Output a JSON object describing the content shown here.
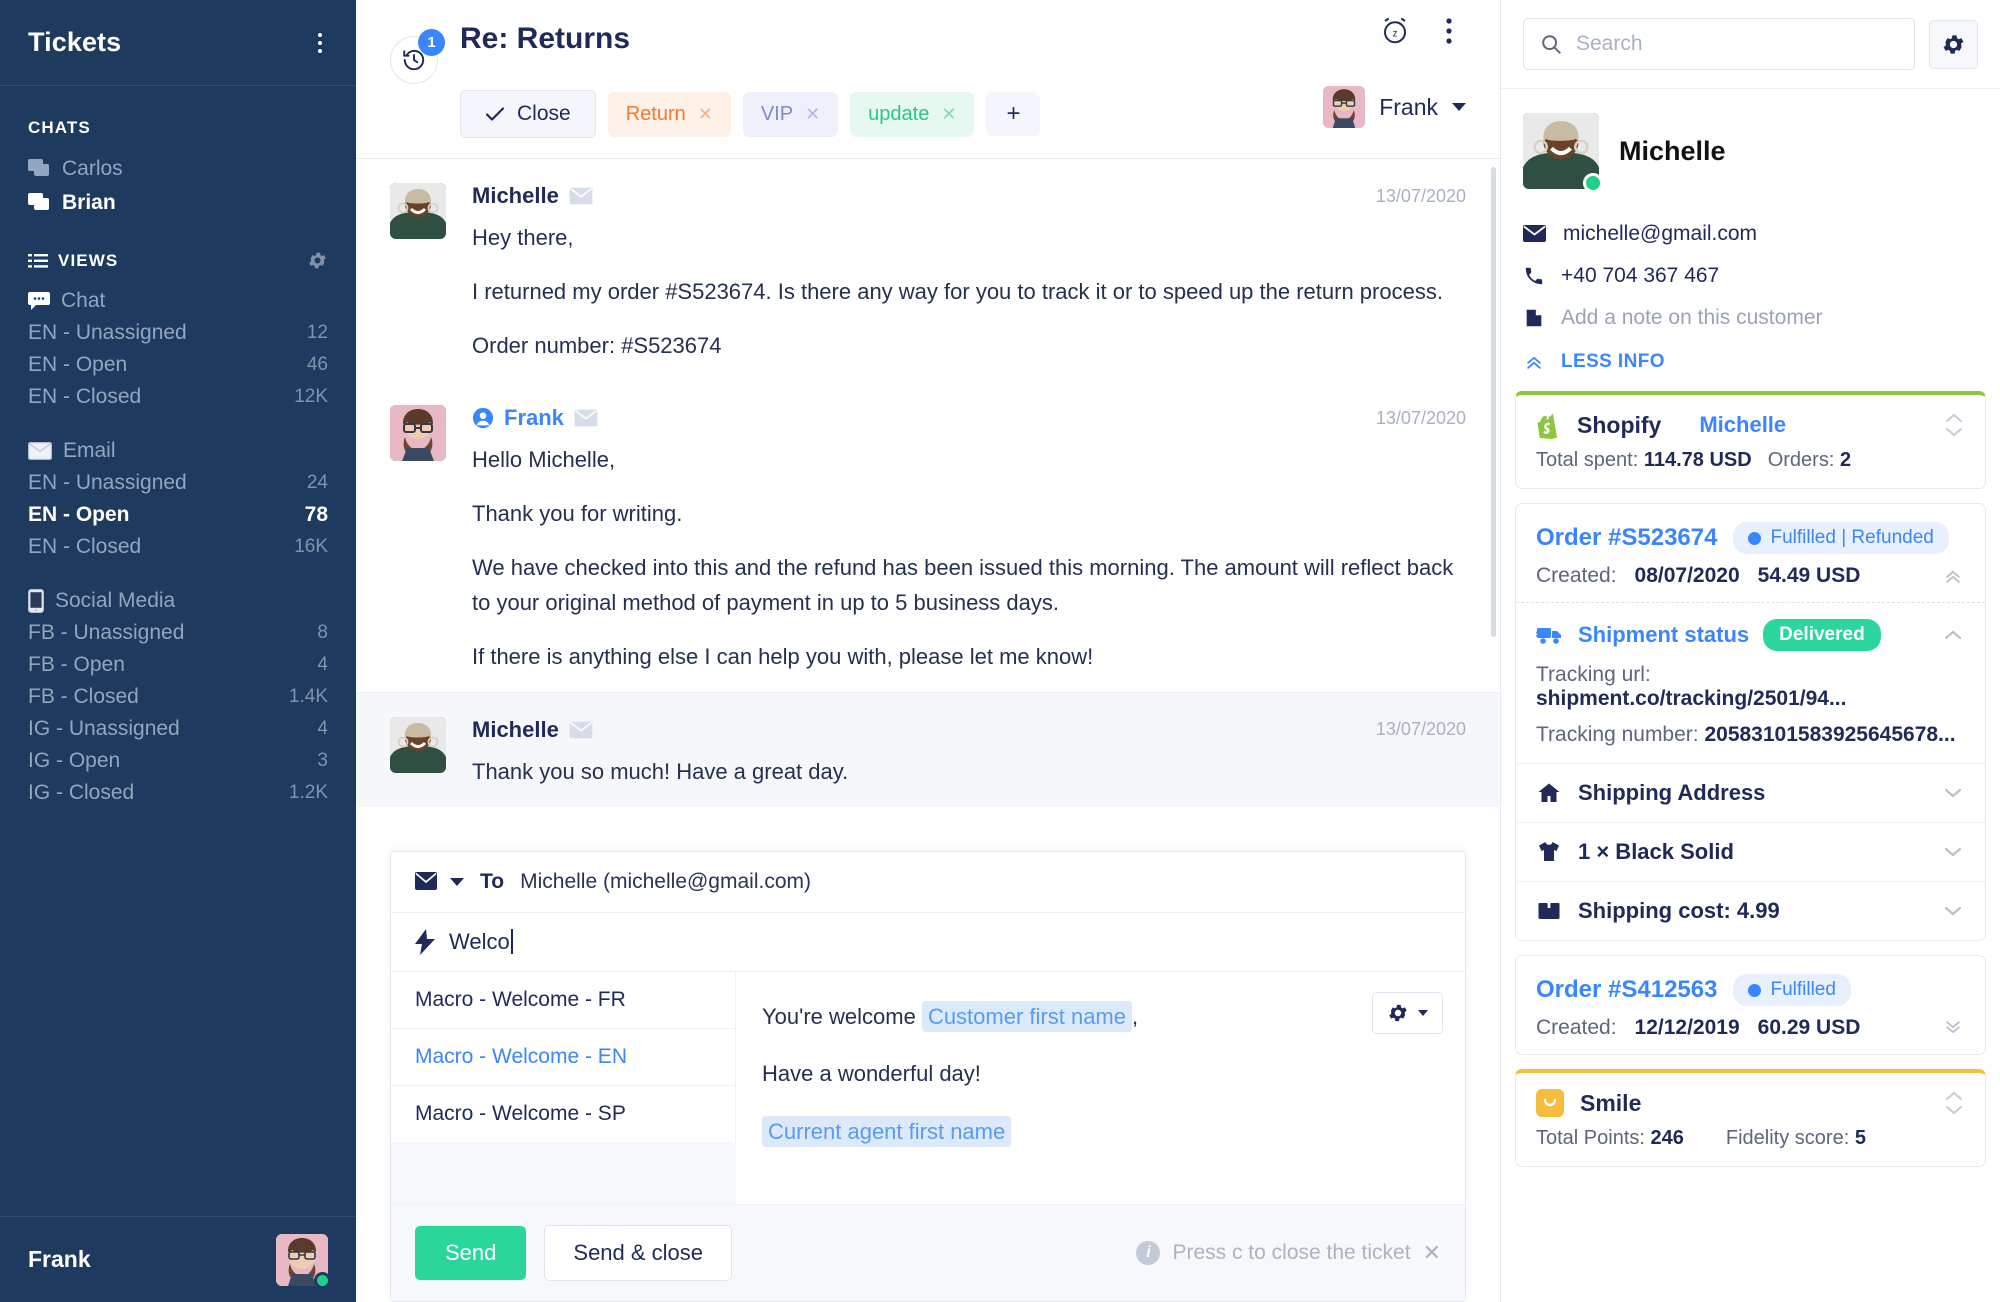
{
  "sidebar": {
    "title": "Tickets",
    "chats_label": "CHATS",
    "chats": [
      {
        "name": "Carlos",
        "active": false
      },
      {
        "name": "Brian",
        "active": true
      }
    ],
    "views_label": "VIEWS",
    "groups": [
      {
        "head": "Chat",
        "icon": "chat-bubble-icon",
        "items": [
          {
            "label": "EN - Unassigned",
            "count": "12",
            "selected": false
          },
          {
            "label": "EN - Open",
            "count": "46",
            "selected": false
          },
          {
            "label": "EN - Closed",
            "count": "12K",
            "selected": false
          }
        ]
      },
      {
        "head": "Email",
        "icon": "envelope-icon",
        "items": [
          {
            "label": "EN - Unassigned",
            "count": "24",
            "selected": false
          },
          {
            "label": "EN - Open",
            "count": "78",
            "selected": true
          },
          {
            "label": "EN - Closed",
            "count": "16K",
            "selected": false
          }
        ]
      },
      {
        "head": "Social Media",
        "icon": "mobile-phone-icon",
        "items": [
          {
            "label": "FB - Unassigned",
            "count": "8",
            "selected": false
          },
          {
            "label": "FB - Open",
            "count": "4",
            "selected": false
          },
          {
            "label": "FB - Closed",
            "count": "1.4K",
            "selected": false
          },
          {
            "label": "IG - Unassigned",
            "count": "4",
            "selected": false
          },
          {
            "label": "IG - Open",
            "count": "3",
            "selected": false
          },
          {
            "label": "IG - Closed",
            "count": "1.2K",
            "selected": false
          }
        ]
      }
    ],
    "current_user": "Frank"
  },
  "ticket": {
    "title": "Re: Returns",
    "history_badge": "1",
    "close_label": "Close",
    "tags": [
      {
        "label": "Return",
        "style": "tag-return"
      },
      {
        "label": "VIP",
        "style": "tag-vip"
      },
      {
        "label": "update",
        "style": "tag-update"
      }
    ],
    "add_tag_label": "+",
    "assignee": "Frank"
  },
  "messages": [
    {
      "author": "Michelle",
      "is_agent": false,
      "date": "13/07/2020",
      "paragraphs": [
        "Hey there,",
        "I returned my order #S523674. Is there any way for you to track it or to speed up the return process.",
        "Order number: #S523674"
      ]
    },
    {
      "author": "Frank",
      "is_agent": true,
      "date": "13/07/2020",
      "paragraphs": [
        "Hello Michelle,",
        "Thank you for writing.",
        "We have checked into this and the refund has been issued this morning. The amount will reflect back to your original method of payment in up to 5 business days.",
        "If there is anything else I can help you with, please let me know!"
      ]
    },
    {
      "author": "Michelle",
      "is_agent": false,
      "date": "13/07/2020",
      "paragraphs": [
        "Thank you so much! Have a great day."
      ]
    }
  ],
  "composer": {
    "to_label": "To",
    "to_value": "Michelle (michelle@gmail.com)",
    "typed_text": "Welco",
    "macros": [
      {
        "label": "Macro - Welcome - FR",
        "active": false
      },
      {
        "label": "Macro - Welcome - EN",
        "active": true
      },
      {
        "label": "Macro - Welcome - SP",
        "active": false
      }
    ],
    "preview": {
      "line1_pre": "You're welcome",
      "line1_token": "Customer first name",
      "line1_post": ",",
      "line2": "Have a wonderful day!",
      "line3_token": "Current agent first name"
    },
    "send_label": "Send",
    "send_close_label": "Send & close",
    "hint_text": "Press c to close the ticket"
  },
  "right": {
    "search": {
      "placeholder": "Search",
      "value": ""
    },
    "customer": {
      "name": "Michelle",
      "email": "michelle@gmail.com",
      "phone": "+40 704 367 467",
      "note_placeholder": "Add a note on this customer",
      "less_info_label": "LESS INFO"
    },
    "shopify": {
      "title": "Shopify",
      "customer_link": "Michelle",
      "total_spent_label": "Total spent:",
      "total_spent_value": "114.78 USD",
      "orders_label": "Orders:",
      "orders_value": "2"
    },
    "orders": [
      {
        "id": "Order #S523674",
        "status": "Fulfilled | Refunded",
        "created_label": "Created:",
        "created": "08/07/2020",
        "amount": "54.49 USD",
        "expanded": true,
        "shipment": {
          "label": "Shipment status",
          "badge": "Delivered",
          "tracking_url_label": "Tracking url:",
          "tracking_url": "shipment.co/tracking/2501/94...",
          "tracking_number_label": "Tracking number:",
          "tracking_number": "20583101583925645678..."
        },
        "rows": [
          {
            "label": "Shipping Address",
            "icon": "home-icon"
          },
          {
            "label": "1 × Black Solid",
            "icon": "tshirt-icon"
          },
          {
            "label": "Shipping cost: 4.99",
            "icon": "box-icon"
          }
        ]
      },
      {
        "id": "Order #S412563",
        "status": "Fulfilled",
        "created_label": "Created:",
        "created": "12/12/2019",
        "amount": "60.29 USD",
        "expanded": false
      }
    ],
    "smile": {
      "title": "Smile",
      "total_points_label": "Total Points:",
      "total_points_value": "246",
      "fidelity_label": "Fidelity score:",
      "fidelity_value": "5"
    }
  },
  "colors": {
    "sidebar_bg": "#1e3a5f",
    "accent_blue": "#3a86ff",
    "green": "#2bd69b",
    "shopify_green": "#8cc63f",
    "smile_yellow": "#f6bc3e",
    "tag_return": "#f07c32",
    "tag_vip": "#7b8cc9",
    "tag_update": "#2bc48a"
  }
}
